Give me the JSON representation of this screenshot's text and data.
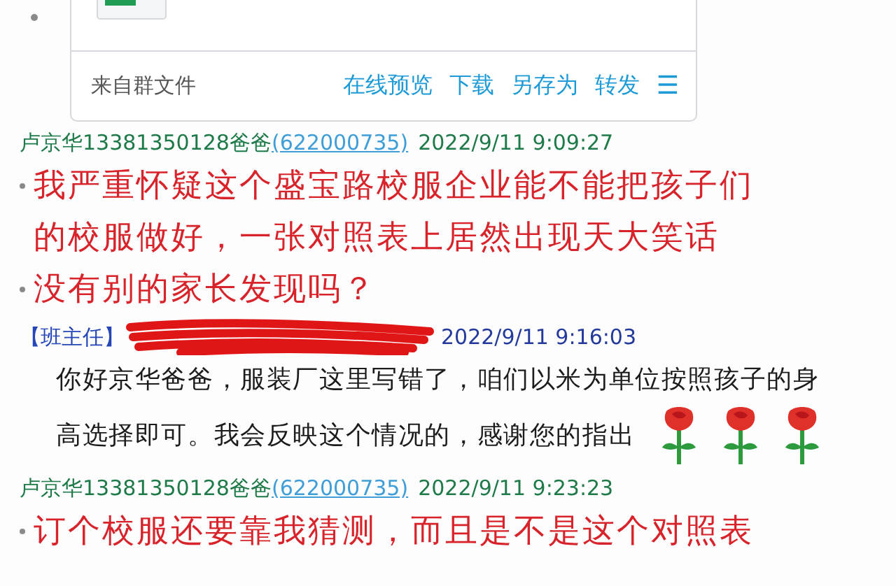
{
  "file_card": {
    "source": "来自群文件",
    "actions": [
      "在线预览",
      "下载",
      "另存为",
      "转发"
    ],
    "menu": "☰"
  },
  "messages": [
    {
      "header": {
        "kind": "member",
        "name": "卢京华13381350128爸爸",
        "id": "(622000735)",
        "time": "2022/9/11 9:09:27"
      },
      "body": {
        "kind": "alert",
        "paragraphs": [
          "我严重怀疑这个盛宝路校服企业能不能把孩子们的校服做好，一张对照表上居然出现天大笑话",
          "没有别的家长发现吗？"
        ]
      }
    },
    {
      "header": {
        "kind": "teacher",
        "role": "【班主任】",
        "time": "2022/9/11 9:16:03"
      },
      "body": {
        "kind": "normal",
        "paragraphs": [
          "你好京华爸爸，服装厂这里写错了，咱们以米为单位按照孩子的身",
          "高选择即可。我会反映这个情况的，感谢您的指出"
        ],
        "emoji": [
          {
            "kind": "rose"
          },
          {
            "kind": "rose"
          },
          {
            "kind": "rose"
          }
        ]
      }
    },
    {
      "header": {
        "kind": "member",
        "name": "卢京华13381350128爸爸",
        "id": "(622000735)",
        "time": "2022/9/11 9:23:23"
      },
      "body": {
        "kind": "alert",
        "paragraphs": [
          "订个校服还要靠我猜测，而且是不是这个对照表"
        ]
      }
    }
  ]
}
